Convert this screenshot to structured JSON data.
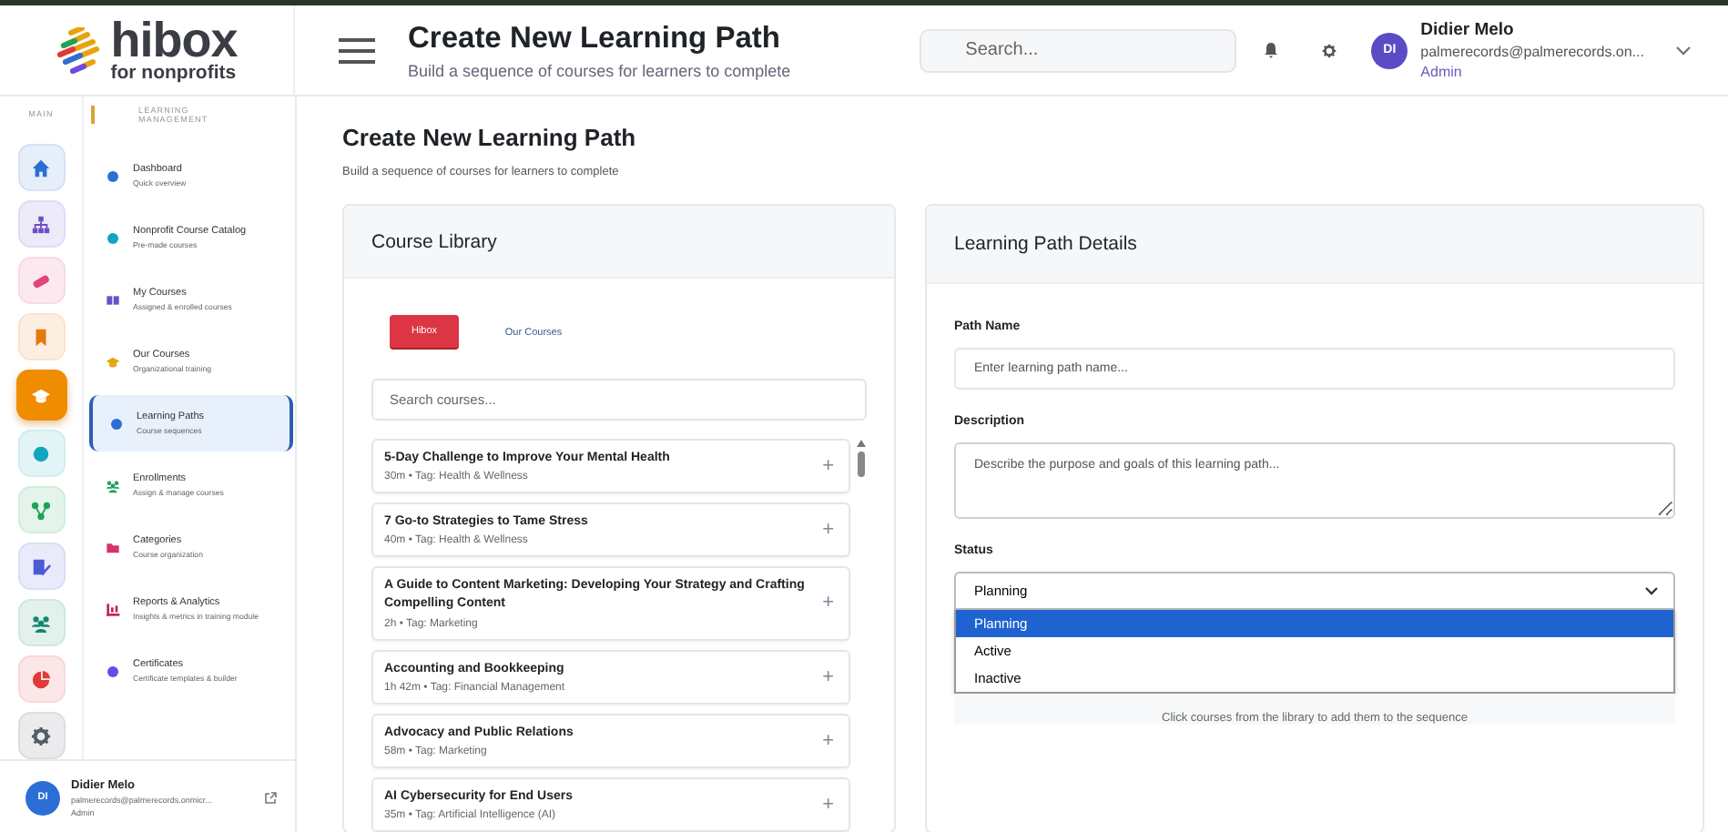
{
  "brand": {
    "name": "hibox",
    "tagline": "for nonprofits"
  },
  "header": {
    "title": "Create New Learning Path",
    "subtitle": "Build a sequence of courses for learners to complete",
    "search": {
      "placeholder": "Search..."
    },
    "user": {
      "initials": "DI",
      "name": "Didier Melo",
      "email": "palmerecords@palmerecords.on...",
      "role": "Admin"
    }
  },
  "rail": {
    "label": "MAIN",
    "items": [
      {
        "kind": "home",
        "color": "#2b6fd6",
        "selected": false
      },
      {
        "kind": "sitemap",
        "color": "#6b4fc9",
        "selected": false
      },
      {
        "kind": "pill",
        "color": "#e0447a",
        "selected": false
      },
      {
        "kind": "bookmark",
        "color": "#e8780c",
        "selected": false
      },
      {
        "kind": "cap",
        "color": "#f08c00",
        "selected": true
      },
      {
        "kind": "dot",
        "color": "#12a5c0",
        "selected": false
      },
      {
        "kind": "share",
        "color": "#1aa35a",
        "selected": false
      },
      {
        "kind": "edit",
        "color": "#4a5bd4",
        "selected": false
      },
      {
        "kind": "users",
        "color": "#15886a",
        "selected": false
      },
      {
        "kind": "pie",
        "color": "#e03a3a",
        "selected": false
      },
      {
        "kind": "gear",
        "color": "#555b66",
        "selected": false
      }
    ]
  },
  "nav": {
    "section": "LEARNING MANAGEMENT",
    "items": [
      {
        "kind": "dot",
        "color": "#2b6fd6",
        "label": "Dashboard",
        "sub": "Quick overview",
        "selected": false
      },
      {
        "kind": "dot",
        "color": "#12a5c0",
        "label": "Nonprofit Course Catalog",
        "sub": "Pre-made courses",
        "selected": false
      },
      {
        "kind": "book",
        "color": "#6b4fc9",
        "label": "My Courses",
        "sub": "Assigned & enrolled courses",
        "selected": false
      },
      {
        "kind": "cap",
        "color": "#e8a30c",
        "label": "Our Courses",
        "sub": "Organizational training",
        "selected": false
      },
      {
        "kind": "dot",
        "color": "#2b6fd6",
        "label": "Learning Paths",
        "sub": "Course sequences",
        "selected": true
      },
      {
        "kind": "users",
        "color": "#1aa35a",
        "label": "Enrollments",
        "sub": "Assign & manage courses",
        "selected": false
      },
      {
        "kind": "folder",
        "color": "#d6336c",
        "label": "Categories",
        "sub": "Course organization",
        "selected": false
      },
      {
        "kind": "chart",
        "color": "#c2255c",
        "label": "Reports & Analytics",
        "sub": "Insights & metrics in training module",
        "selected": false
      },
      {
        "kind": "dot",
        "color": "#7048e8",
        "label": "Certificates",
        "sub": "Certificate templates & builder",
        "selected": false
      }
    ]
  },
  "sidebar_user": {
    "initials": "DI",
    "name": "Didier Melo",
    "email": "palmerecords@palmerecords.onmicr...",
    "role": "Admin"
  },
  "page": {
    "title": "Create New Learning Path",
    "subtitle": "Build a sequence of courses for learners to complete"
  },
  "library": {
    "title": "Course Library",
    "tabs": [
      {
        "label": "Hibox",
        "selected": true
      },
      {
        "label": "Our Courses",
        "selected": false
      }
    ],
    "search": {
      "placeholder": "Search courses..."
    },
    "courses": [
      {
        "title": "5-Day Challenge to Improve Your Mental Health",
        "meta": "30m • Tag: Health & Wellness",
        "add": "+"
      },
      {
        "title": "7 Go-to Strategies to Tame Stress",
        "meta": "40m • Tag: Health & Wellness",
        "add": "+"
      },
      {
        "title": "A Guide to Content Marketing: Developing Your Strategy and Crafting Compelling Content",
        "meta": "2h • Tag: Marketing",
        "add": "+"
      },
      {
        "title": "Accounting and Bookkeeping",
        "meta": "1h 42m • Tag: Financial Management",
        "add": "+"
      },
      {
        "title": "Advocacy and Public Relations",
        "meta": "58m • Tag: Marketing",
        "add": "+"
      },
      {
        "title": "AI Cybersecurity for End Users",
        "meta": "35m • Tag: Artificial Intelligence (AI)",
        "add": "+"
      }
    ]
  },
  "details": {
    "title": "Learning Path Details",
    "name_field": {
      "label": "Path Name",
      "placeholder": "Enter learning path name..."
    },
    "description": {
      "label": "Description",
      "placeholder": "Describe the purpose and goals of this learning path..."
    },
    "status": {
      "label": "Status",
      "value": "Planning",
      "expanded": true,
      "options": [
        {
          "label": "Planning",
          "selected": true
        },
        {
          "label": "Active",
          "selected": false
        },
        {
          "label": "Inactive",
          "selected": false
        }
      ]
    },
    "empty_hint": "Click courses from the library to add them to the sequence"
  }
}
